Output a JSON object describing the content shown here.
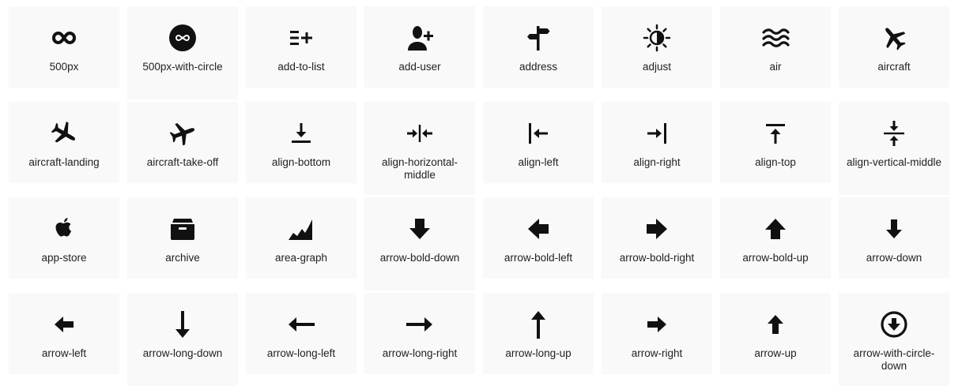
{
  "icons": [
    {
      "label": "500px",
      "icon": "500px-icon"
    },
    {
      "label": "500px-with-circle",
      "icon": "500px-with-circle-icon"
    },
    {
      "label": "add-to-list",
      "icon": "add-to-list-icon"
    },
    {
      "label": "add-user",
      "icon": "add-user-icon"
    },
    {
      "label": "address",
      "icon": "address-icon"
    },
    {
      "label": "adjust",
      "icon": "adjust-icon"
    },
    {
      "label": "air",
      "icon": "air-icon"
    },
    {
      "label": "aircraft",
      "icon": "aircraft-icon"
    },
    {
      "label": "aircraft-landing",
      "icon": "aircraft-landing-icon"
    },
    {
      "label": "aircraft-take-off",
      "icon": "aircraft-take-off-icon"
    },
    {
      "label": "align-bottom",
      "icon": "align-bottom-icon"
    },
    {
      "label": "align-horizontal-middle",
      "icon": "align-horizontal-middle-icon"
    },
    {
      "label": "align-left",
      "icon": "align-left-icon"
    },
    {
      "label": "align-right",
      "icon": "align-right-icon"
    },
    {
      "label": "align-top",
      "icon": "align-top-icon"
    },
    {
      "label": "align-vertical-middle",
      "icon": "align-vertical-middle-icon"
    },
    {
      "label": "app-store",
      "icon": "app-store-icon"
    },
    {
      "label": "archive",
      "icon": "archive-icon"
    },
    {
      "label": "area-graph",
      "icon": "area-graph-icon"
    },
    {
      "label": "arrow-bold-down",
      "icon": "arrow-bold-down-icon"
    },
    {
      "label": "arrow-bold-left",
      "icon": "arrow-bold-left-icon"
    },
    {
      "label": "arrow-bold-right",
      "icon": "arrow-bold-right-icon"
    },
    {
      "label": "arrow-bold-up",
      "icon": "arrow-bold-up-icon"
    },
    {
      "label": "arrow-down",
      "icon": "arrow-down-icon"
    },
    {
      "label": "arrow-left",
      "icon": "arrow-left-icon"
    },
    {
      "label": "arrow-long-down",
      "icon": "arrow-long-down-icon"
    },
    {
      "label": "arrow-long-left",
      "icon": "arrow-long-left-icon"
    },
    {
      "label": "arrow-long-right",
      "icon": "arrow-long-right-icon"
    },
    {
      "label": "arrow-long-up",
      "icon": "arrow-long-up-icon"
    },
    {
      "label": "arrow-right",
      "icon": "arrow-right-icon"
    },
    {
      "label": "arrow-up",
      "icon": "arrow-up-icon"
    },
    {
      "label": "arrow-with-circle-down",
      "icon": "arrow-with-circle-down-icon"
    }
  ]
}
